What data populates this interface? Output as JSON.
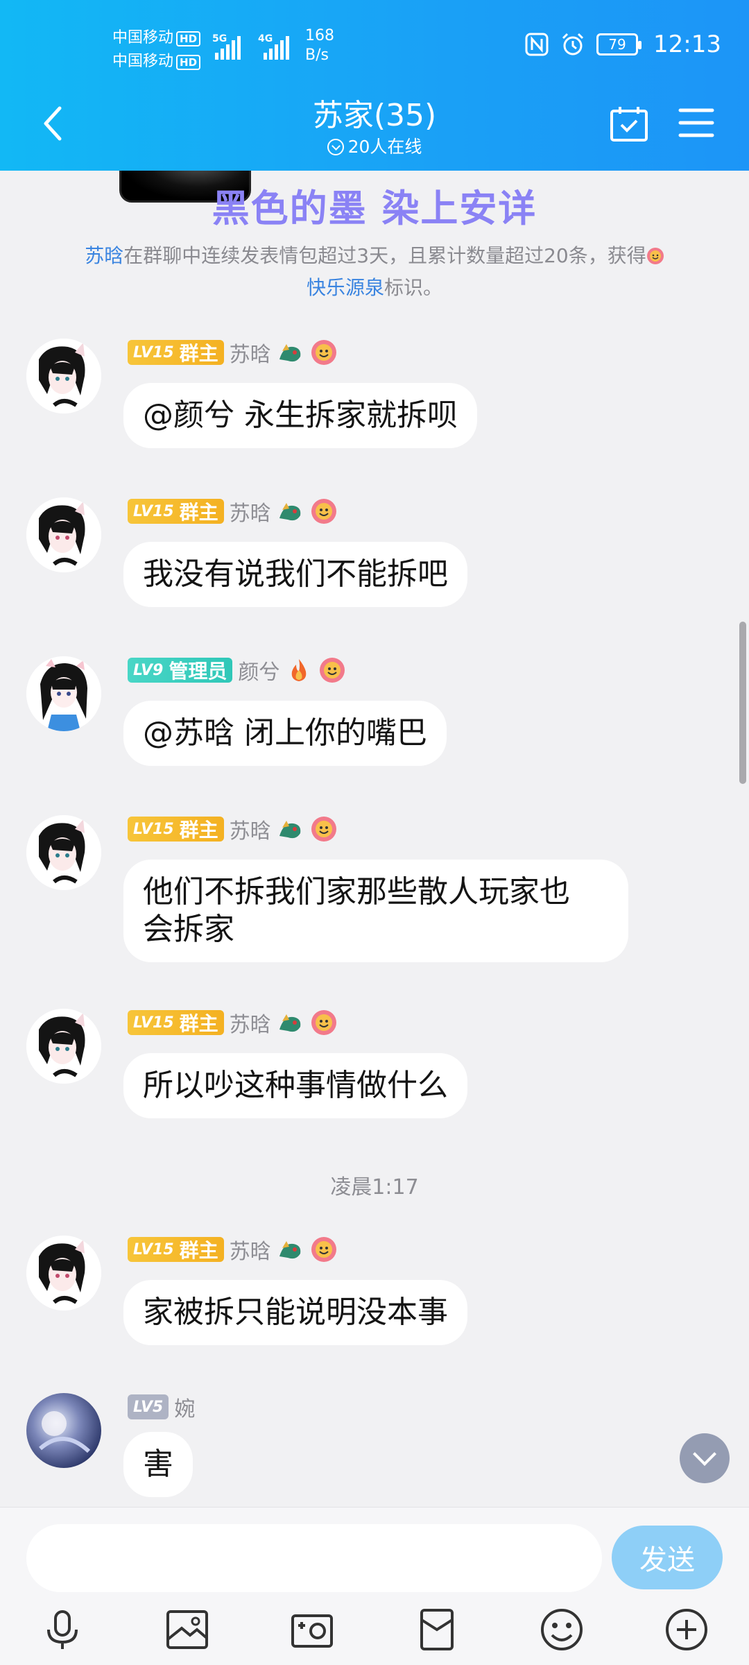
{
  "status_bar": {
    "carrier1": "中国移动",
    "carrier2": "中国移动",
    "hd_label": "HD",
    "net_type1": "5G",
    "net_type2": "4G",
    "net_speed_value": "168",
    "net_speed_unit": "B/s",
    "battery": "79",
    "time": "12:13"
  },
  "header": {
    "title": "苏家(35)",
    "online": "20人在线"
  },
  "banner": {
    "text": "黑色的墨 染上安详"
  },
  "notice": {
    "user": "苏晗",
    "text1": "在群聊中连续发表情包超过3天，且累计数量超过20条，获得",
    "badge_name": "快乐源泉",
    "text2": "标识。"
  },
  "messages": [
    {
      "level": "LV15",
      "role": "群主",
      "name": "苏晗",
      "text": "@颜兮 永生拆家就拆呗"
    },
    {
      "level": "LV15",
      "role": "群主",
      "name": "苏晗",
      "text": "我没有说我们不能拆吧"
    },
    {
      "level": "LV9",
      "role": "管理员",
      "name": "颜兮",
      "text": "@苏晗 闭上你的嘴巴"
    },
    {
      "level": "LV15",
      "role": "群主",
      "name": "苏晗",
      "text_line1": "他们不拆我们家那些散人玩家也",
      "text_line2": "会拆家"
    },
    {
      "level": "LV15",
      "role": "群主",
      "name": "苏晗",
      "text": "所以吵这种事情做什么"
    },
    {
      "level": "LV15",
      "role": "群主",
      "name": "苏晗",
      "text": "家被拆只能说明没本事"
    },
    {
      "level": "LV5",
      "name": "婉",
      "text": "害"
    }
  ],
  "timestamp": "凌晨1:17",
  "input": {
    "value": "",
    "send_label": "发送"
  },
  "icons": {
    "back": "back-icon",
    "calendar": "calendar-check-icon",
    "menu": "menu-icon",
    "mic": "microphone-icon",
    "image": "image-icon",
    "camera": "camera-icon",
    "redpacket": "red-packet-icon",
    "emoji": "emoji-icon",
    "plus": "plus-icon"
  },
  "colors": {
    "header": "#1aa0f6",
    "link": "#3a84e0",
    "banner_text": "#8a82f5",
    "owner_badge": "#f4b122",
    "admin_badge": "#2fc7b8",
    "member_badge": "#aeb3c4",
    "send_button": "#8ecff7"
  }
}
